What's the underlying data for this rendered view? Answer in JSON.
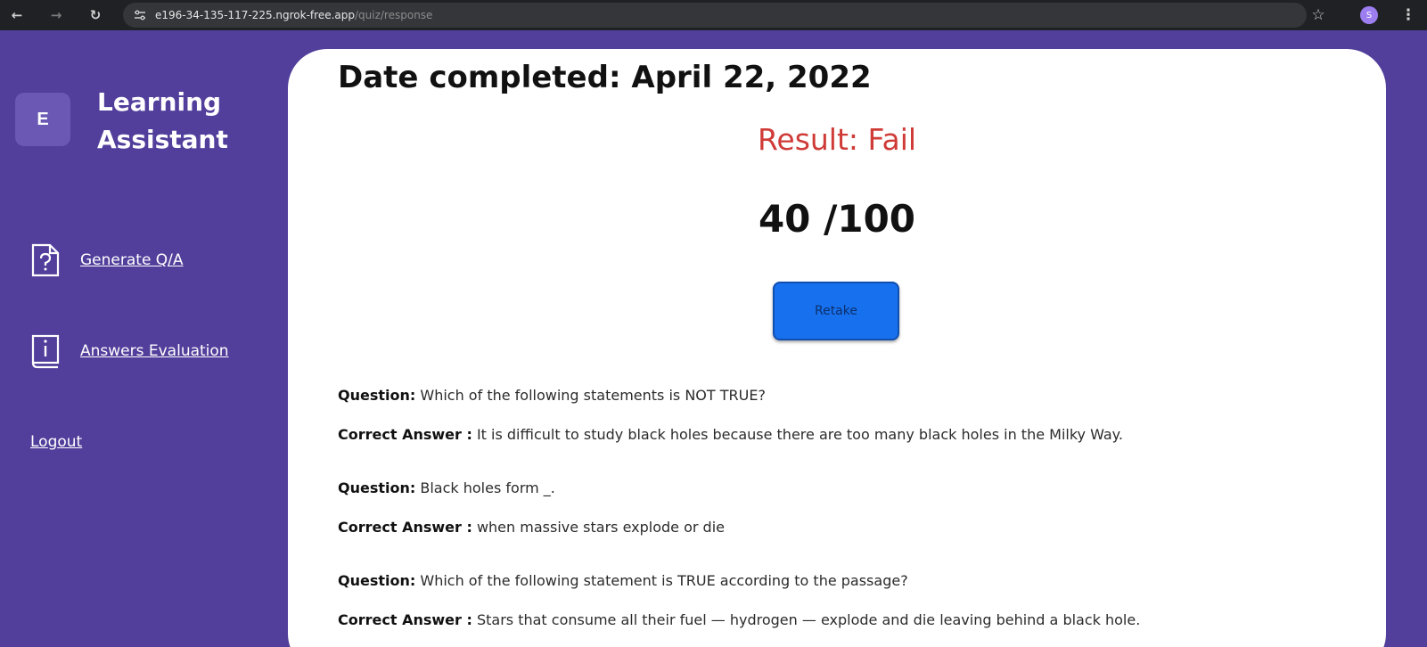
{
  "browser": {
    "url_host": "e196-34-135-117-225.ngrok-free.app",
    "url_path": "/quiz/response",
    "back_icon": "arrow-left-icon",
    "forward_icon": "arrow-right-icon",
    "reload_icon": "reload-icon",
    "profile_initial": "S"
  },
  "sidebar": {
    "logo_letter": "E",
    "app_title_line1": "Learning",
    "app_title_line2": "Assistant",
    "items": [
      {
        "label": "Generate Q/A",
        "icon": "question-file-icon"
      },
      {
        "label": "Answers Evaluation",
        "icon": "info-book-icon"
      }
    ],
    "logout_label": "Logout"
  },
  "main": {
    "date_completed": "Date completed: April 22, 2022",
    "result": "Result: Fail",
    "score": "40 /100",
    "retake_label": "Retake",
    "question_label": "Question:",
    "answer_label": "Correct Answer :",
    "qa": [
      {
        "question": "Which of the following statements is NOT TRUE?",
        "answer": "It is difficult to study black holes because there are too many black holes in the Milky Way."
      },
      {
        "question": "Black holes form _.",
        "answer": "when massive stars explode or die"
      },
      {
        "question": "Which of the following statement is TRUE according to the passage?",
        "answer": "Stars that consume all their fuel — hydrogen — explode and die leaving behind a black hole."
      }
    ]
  },
  "colors": {
    "sidebar_bg": "#523e9b",
    "result_fail": "#cf3b37",
    "retake_button": "#1771ef"
  }
}
